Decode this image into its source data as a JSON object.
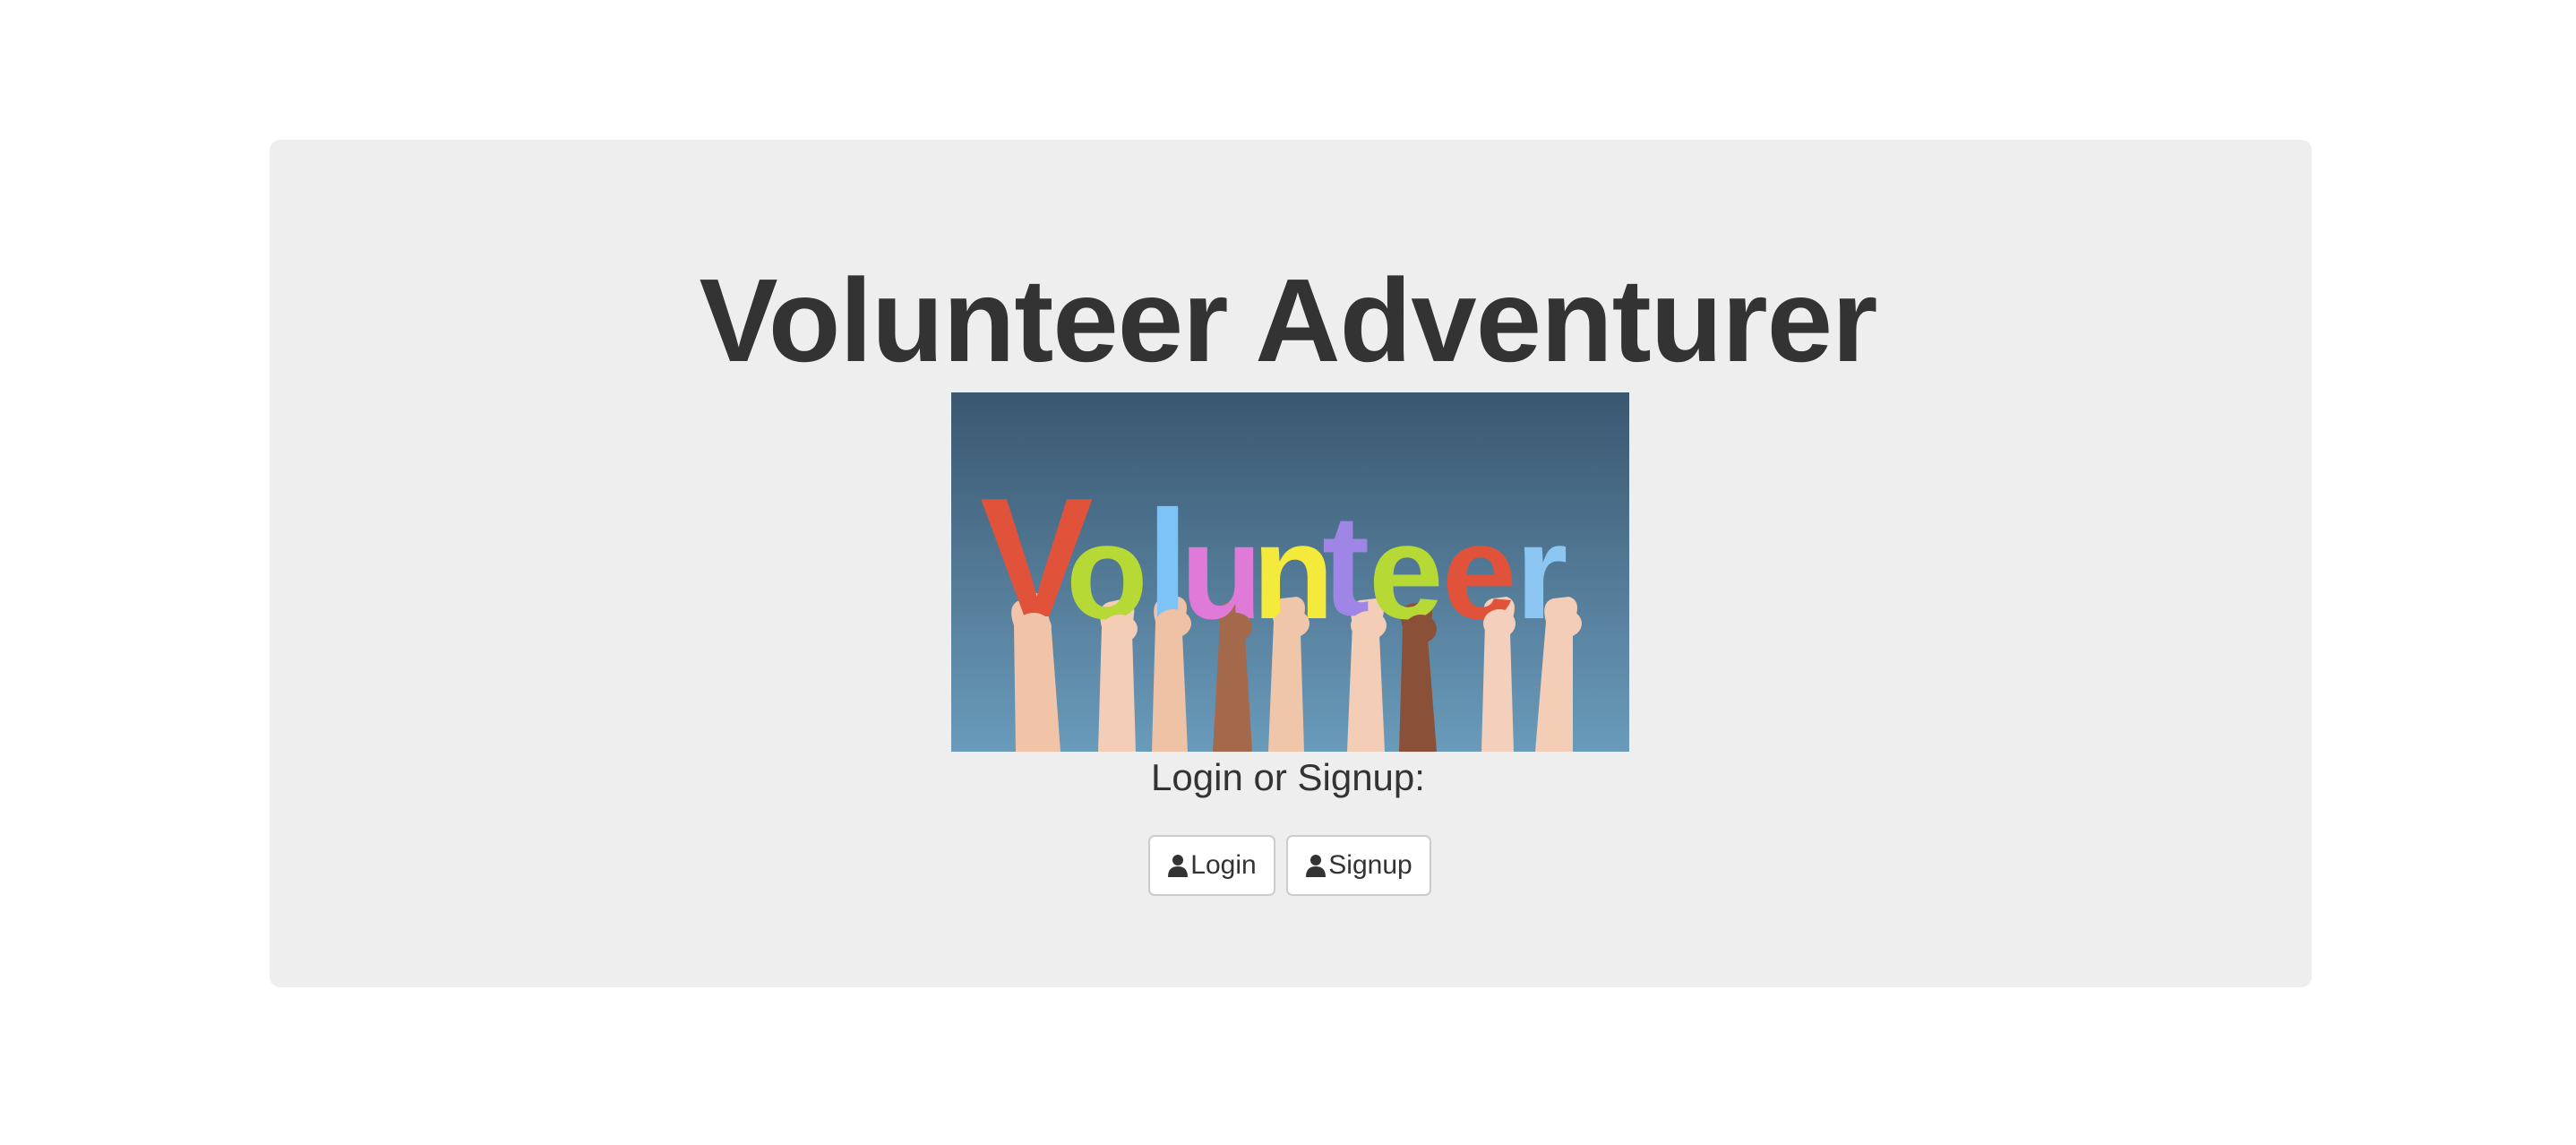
{
  "page": {
    "title": "Volunteer Adventurer",
    "subtitle": "Login or Signup:"
  },
  "hero_image": {
    "lettering": "Volunteer",
    "letter_colors": [
      "#e0533a",
      "#b7d935",
      "#7ec3f5",
      "#e07ad8",
      "#f4ea3c",
      "#b7d935",
      "#9f86e6",
      "#b7d935",
      "#e0533a",
      "#8cc7f4"
    ]
  },
  "buttons": {
    "login": {
      "icon": "user-icon",
      "label": "Login"
    },
    "signup": {
      "icon": "user-icon",
      "label": "Signup"
    }
  },
  "colors": {
    "jumbotron_background": "#eeeeee",
    "text": "#333333",
    "button_border": "#cccccc",
    "image_sky_top": "#3a5770",
    "image_sky_bottom": "#6a9bbb"
  }
}
